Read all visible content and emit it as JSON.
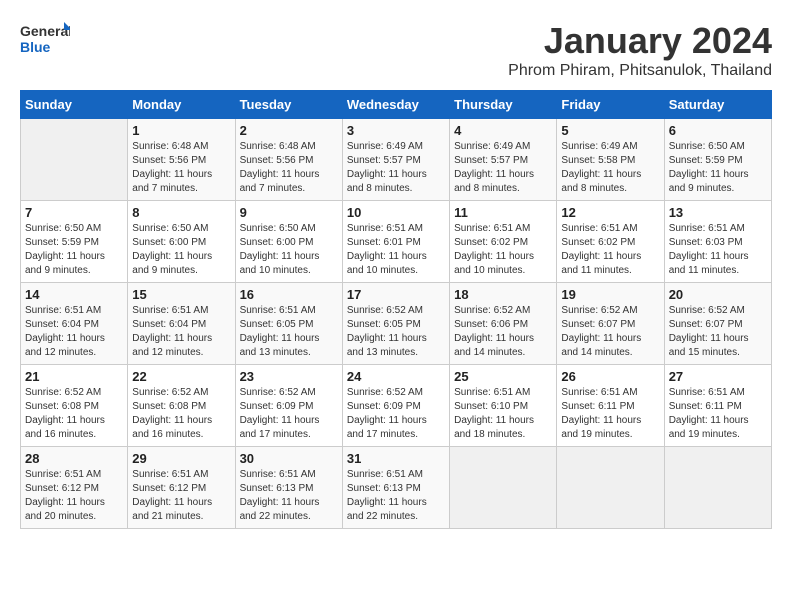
{
  "header": {
    "logo_general": "General",
    "logo_blue": "Blue",
    "title": "January 2024",
    "subtitle": "Phrom Phiram, Phitsanulok, Thailand"
  },
  "days_of_week": [
    "Sunday",
    "Monday",
    "Tuesday",
    "Wednesday",
    "Thursday",
    "Friday",
    "Saturday"
  ],
  "weeks": [
    [
      {
        "day": "",
        "info": ""
      },
      {
        "day": "1",
        "info": "Sunrise: 6:48 AM\nSunset: 5:56 PM\nDaylight: 11 hours\nand 7 minutes."
      },
      {
        "day": "2",
        "info": "Sunrise: 6:48 AM\nSunset: 5:56 PM\nDaylight: 11 hours\nand 7 minutes."
      },
      {
        "day": "3",
        "info": "Sunrise: 6:49 AM\nSunset: 5:57 PM\nDaylight: 11 hours\nand 8 minutes."
      },
      {
        "day": "4",
        "info": "Sunrise: 6:49 AM\nSunset: 5:57 PM\nDaylight: 11 hours\nand 8 minutes."
      },
      {
        "day": "5",
        "info": "Sunrise: 6:49 AM\nSunset: 5:58 PM\nDaylight: 11 hours\nand 8 minutes."
      },
      {
        "day": "6",
        "info": "Sunrise: 6:50 AM\nSunset: 5:59 PM\nDaylight: 11 hours\nand 9 minutes."
      }
    ],
    [
      {
        "day": "7",
        "info": "Sunrise: 6:50 AM\nSunset: 5:59 PM\nDaylight: 11 hours\nand 9 minutes."
      },
      {
        "day": "8",
        "info": "Sunrise: 6:50 AM\nSunset: 6:00 PM\nDaylight: 11 hours\nand 9 minutes."
      },
      {
        "day": "9",
        "info": "Sunrise: 6:50 AM\nSunset: 6:00 PM\nDaylight: 11 hours\nand 10 minutes."
      },
      {
        "day": "10",
        "info": "Sunrise: 6:51 AM\nSunset: 6:01 PM\nDaylight: 11 hours\nand 10 minutes."
      },
      {
        "day": "11",
        "info": "Sunrise: 6:51 AM\nSunset: 6:02 PM\nDaylight: 11 hours\nand 10 minutes."
      },
      {
        "day": "12",
        "info": "Sunrise: 6:51 AM\nSunset: 6:02 PM\nDaylight: 11 hours\nand 11 minutes."
      },
      {
        "day": "13",
        "info": "Sunrise: 6:51 AM\nSunset: 6:03 PM\nDaylight: 11 hours\nand 11 minutes."
      }
    ],
    [
      {
        "day": "14",
        "info": "Sunrise: 6:51 AM\nSunset: 6:04 PM\nDaylight: 11 hours\nand 12 minutes."
      },
      {
        "day": "15",
        "info": "Sunrise: 6:51 AM\nSunset: 6:04 PM\nDaylight: 11 hours\nand 12 minutes."
      },
      {
        "day": "16",
        "info": "Sunrise: 6:51 AM\nSunset: 6:05 PM\nDaylight: 11 hours\nand 13 minutes."
      },
      {
        "day": "17",
        "info": "Sunrise: 6:52 AM\nSunset: 6:05 PM\nDaylight: 11 hours\nand 13 minutes."
      },
      {
        "day": "18",
        "info": "Sunrise: 6:52 AM\nSunset: 6:06 PM\nDaylight: 11 hours\nand 14 minutes."
      },
      {
        "day": "19",
        "info": "Sunrise: 6:52 AM\nSunset: 6:07 PM\nDaylight: 11 hours\nand 14 minutes."
      },
      {
        "day": "20",
        "info": "Sunrise: 6:52 AM\nSunset: 6:07 PM\nDaylight: 11 hours\nand 15 minutes."
      }
    ],
    [
      {
        "day": "21",
        "info": "Sunrise: 6:52 AM\nSunset: 6:08 PM\nDaylight: 11 hours\nand 16 minutes."
      },
      {
        "day": "22",
        "info": "Sunrise: 6:52 AM\nSunset: 6:08 PM\nDaylight: 11 hours\nand 16 minutes."
      },
      {
        "day": "23",
        "info": "Sunrise: 6:52 AM\nSunset: 6:09 PM\nDaylight: 11 hours\nand 17 minutes."
      },
      {
        "day": "24",
        "info": "Sunrise: 6:52 AM\nSunset: 6:09 PM\nDaylight: 11 hours\nand 17 minutes."
      },
      {
        "day": "25",
        "info": "Sunrise: 6:51 AM\nSunset: 6:10 PM\nDaylight: 11 hours\nand 18 minutes."
      },
      {
        "day": "26",
        "info": "Sunrise: 6:51 AM\nSunset: 6:11 PM\nDaylight: 11 hours\nand 19 minutes."
      },
      {
        "day": "27",
        "info": "Sunrise: 6:51 AM\nSunset: 6:11 PM\nDaylight: 11 hours\nand 19 minutes."
      }
    ],
    [
      {
        "day": "28",
        "info": "Sunrise: 6:51 AM\nSunset: 6:12 PM\nDaylight: 11 hours\nand 20 minutes."
      },
      {
        "day": "29",
        "info": "Sunrise: 6:51 AM\nSunset: 6:12 PM\nDaylight: 11 hours\nand 21 minutes."
      },
      {
        "day": "30",
        "info": "Sunrise: 6:51 AM\nSunset: 6:13 PM\nDaylight: 11 hours\nand 22 minutes."
      },
      {
        "day": "31",
        "info": "Sunrise: 6:51 AM\nSunset: 6:13 PM\nDaylight: 11 hours\nand 22 minutes."
      },
      {
        "day": "",
        "info": ""
      },
      {
        "day": "",
        "info": ""
      },
      {
        "day": "",
        "info": ""
      }
    ]
  ]
}
